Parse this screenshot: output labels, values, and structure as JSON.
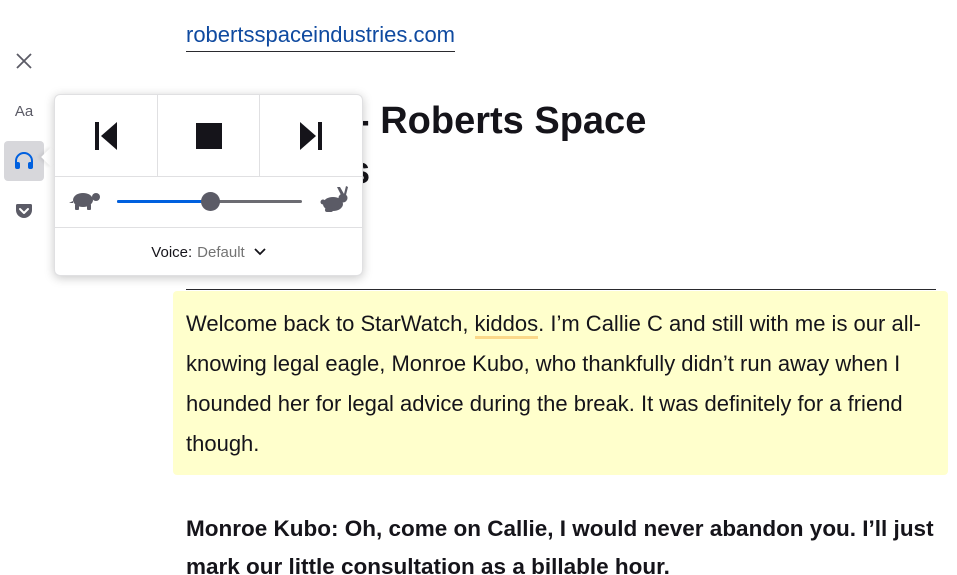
{
  "toolbar": {
    "close_icon": "close-icon",
    "type_controls_label": "Aa",
    "narrate_icon": "headphones-icon",
    "pocket_icon": "pocket-icon"
  },
  "narrate": {
    "prev_icon": "skip-back-icon",
    "stop_icon": "stop-icon",
    "next_icon": "skip-forward-icon",
    "slow_icon": "turtle-icon",
    "fast_icon": "rabbit-icon",
    "rate_fraction": 0.5,
    "voice_label": "Voice:",
    "voice_value": "Default",
    "dropdown_icon": "chevron-down-icon"
  },
  "article": {
    "domain": "robertsspaceindustries.com",
    "title_visible": "h: Bo 2.0 - Roberts Space",
    "title_line2_visible": "s",
    "paragraph_before": "Welcome back to StarWatch, ",
    "paragraph_highlight": "kiddos",
    "paragraph_after": ". I’m Callie C and still with me is our all-knowing legal eagle, Monroe Kubo, who thankfully didn’t run away when I hounded her for legal advice during the break. It was definitely for a friend though.",
    "speaker": "Monroe Kubo",
    "speaker_text": ": Oh, come on Callie, I would never abandon you. I’ll just mark our little consultation as a billable hour."
  },
  "colors": {
    "accent": "#0060df",
    "highlight_bg": "#ffffcc",
    "word_underline": "#fbd889",
    "link": "#0f4aa0"
  }
}
